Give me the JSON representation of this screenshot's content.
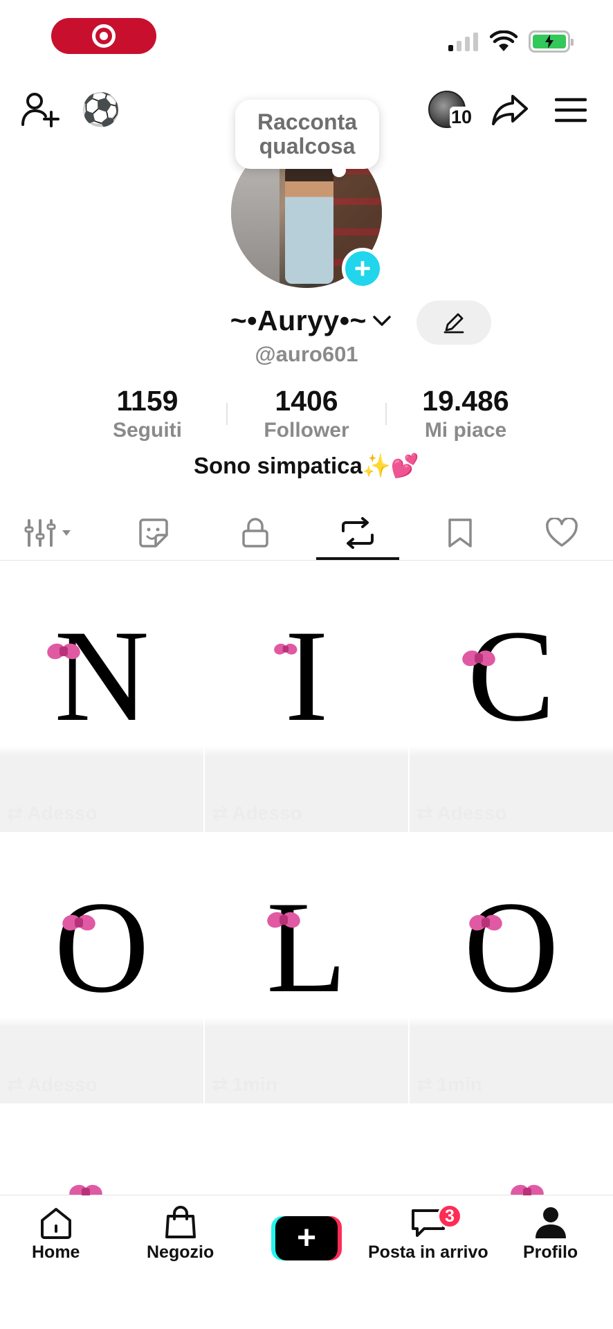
{
  "status_bar": {
    "recording": true,
    "battery_charging": true,
    "colors": {
      "record": "#c8102e",
      "battery": "#34c759"
    }
  },
  "top_bar": {
    "add_friend_icon": "person-plus-icon",
    "soccer_emoji": "⚽",
    "story_count": "10",
    "share_icon": "share-arrow-icon",
    "menu_icon": "hamburger-menu-icon"
  },
  "tooltip": {
    "line1": "Racconta",
    "line2": "qualcosa"
  },
  "profile": {
    "name": "~•Auryy•~",
    "handle": "@auro601",
    "bio": "Sono simpatica✨💕"
  },
  "stats": [
    {
      "value": "1159",
      "label": "Seguiti"
    },
    {
      "value": "1406",
      "label": "Follower"
    },
    {
      "value": "19.486",
      "label": "Mi piace"
    }
  ],
  "tabs": [
    {
      "name": "videos",
      "icon": "grid-filter-icon",
      "active": false
    },
    {
      "name": "stickers",
      "icon": "sticker-icon",
      "active": false
    },
    {
      "name": "private",
      "icon": "lock-icon",
      "active": false
    },
    {
      "name": "reposts",
      "icon": "repost-icon",
      "active": true
    },
    {
      "name": "saved",
      "icon": "bookmark-icon",
      "active": false
    },
    {
      "name": "liked",
      "icon": "heart-icon",
      "active": false
    }
  ],
  "grid": [
    {
      "letter": "N",
      "time": "Adesso"
    },
    {
      "letter": "I",
      "time": "Adesso"
    },
    {
      "letter": "C",
      "time": "Adesso"
    },
    {
      "letter": "O",
      "time": "Adesso"
    },
    {
      "letter": "L",
      "time": "1min"
    },
    {
      "letter": "O",
      "time": "1min"
    },
    {
      "letter": "",
      "time": ""
    },
    {
      "letter": "",
      "time": ""
    },
    {
      "letter": "",
      "time": ""
    }
  ],
  "bottom_nav": {
    "home": "Home",
    "shop": "Negozio",
    "inbox": "Posta in arrivo",
    "inbox_badge": "3",
    "profile": "Profilo"
  },
  "colors": {
    "accent_cyan": "#20d5ec",
    "accent_pink": "#fe2c55",
    "bow_pink": "#e05aa3"
  }
}
